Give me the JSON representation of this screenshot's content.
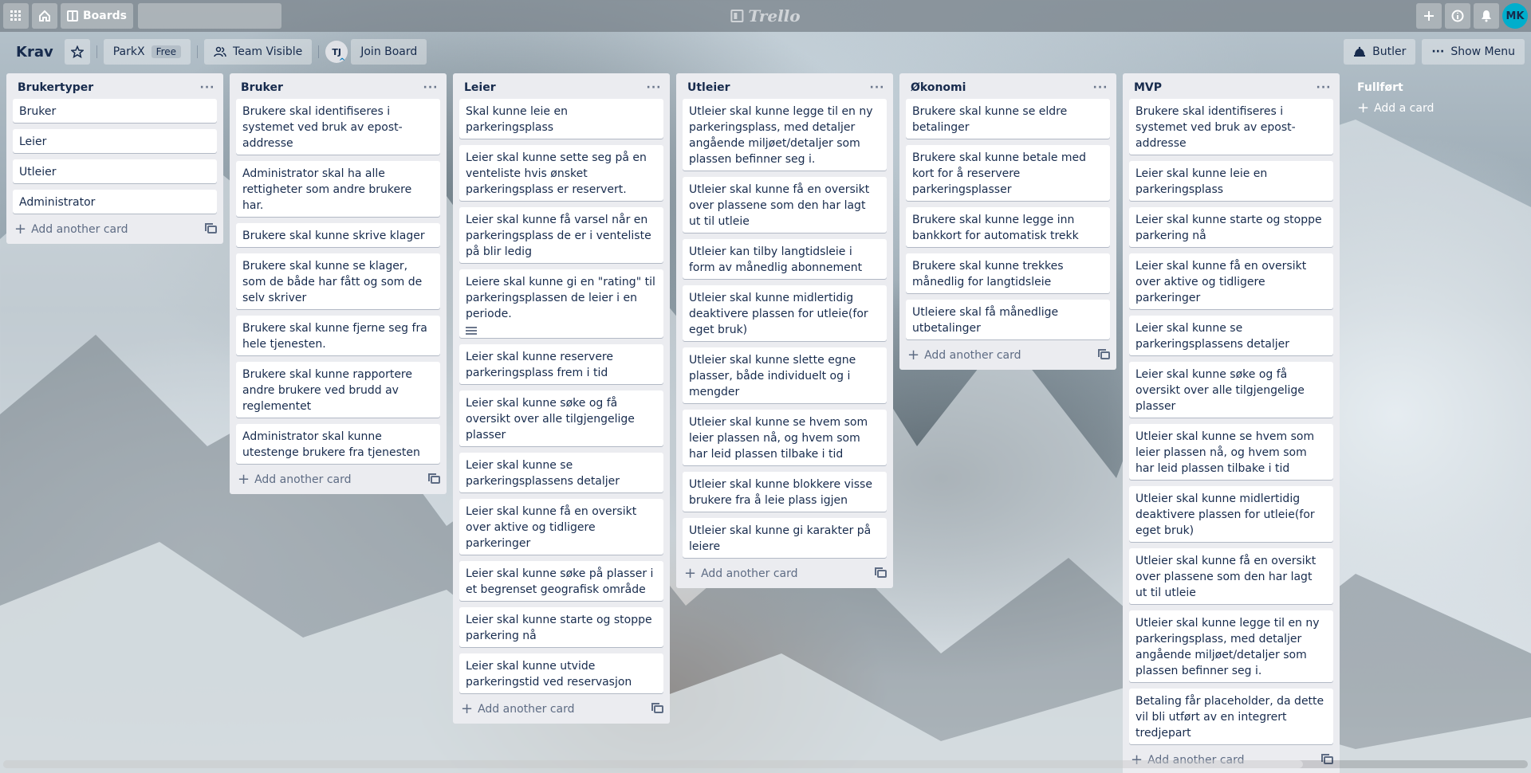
{
  "header": {
    "boards_label": "Boards",
    "search_placeholder": "",
    "logo_text": "Trello",
    "avatar_initials": "MK"
  },
  "board": {
    "title": "Krav",
    "team_name": "ParkX",
    "team_badge": "Free",
    "visibility_label": "Team Visible",
    "member_initials": "TJ",
    "join_label": "Join Board",
    "butler_label": "Butler",
    "menu_label": "Show Menu"
  },
  "lists": [
    {
      "title": "Brukertyper",
      "cards": [
        "Bruker",
        "Leier",
        "Utleier",
        "Administrator"
      ],
      "add_label": "Add another card"
    },
    {
      "title": "Bruker",
      "cards": [
        "Brukere skal identifiseres i systemet ved bruk av epost-addresse",
        "Administrator skal ha alle rettigheter som andre brukere har.",
        "Brukere skal kunne skrive klager",
        "Brukere skal kunne se klager, som de både har fått og som de selv skriver",
        "Brukere skal kunne fjerne seg fra hele tjenesten.",
        "Brukere skal kunne rapportere andre brukere ved brudd av reglementet",
        "Administrator skal kunne utestenge brukere fra tjenesten"
      ],
      "add_label": "Add another card"
    },
    {
      "title": "Leier",
      "cards": [
        "Skal kunne leie en parkeringsplass",
        "Leier skal kunne sette seg på en venteliste hvis ønsket parkeringsplass er reservert.",
        "Leier skal kunne få varsel når en parkeringsplass de er i venteliste på blir ledig",
        "Leiere skal kunne gi en \"rating\" til parkeringsplassen de leier i en periode.",
        "Leier skal kunne reservere parkeringsplass frem i tid",
        "Leier skal kunne søke og få oversikt over alle tilgjengelige plasser",
        "Leier skal kunne se parkeringsplassens detaljer",
        "Leier skal kunne få en oversikt over aktive og tidligere parkeringer",
        "Leier skal kunne søke på plasser i et begrenset geografisk område",
        "Leier skal kunne starte og stoppe parkering nå",
        "Leier skal kunne utvide parkeringstid ved reservasjon"
      ],
      "add_label": "Add another card"
    },
    {
      "title": "Utleier",
      "cards": [
        "Utleier skal kunne legge til en ny parkeringsplass, med detaljer angående miljøet/detaljer som plassen befinner seg i.",
        "Utleier skal kunne få en oversikt over plassene som den har lagt ut til utleie",
        "Utleier kan tilby langtidsleie i form av månedlig abonnement",
        "Utleier skal kunne midlertidig deaktivere plassen for utleie(for eget bruk)",
        "Utleier skal kunne slette egne plasser, både individuelt og i mengder",
        "Utleier skal kunne se hvem som leier plassen nå, og hvem som har leid plassen tilbake i tid",
        "Utleier skal kunne blokkere visse brukere fra å leie plass igjen",
        "Utleier skal kunne gi karakter på leiere"
      ],
      "add_label": "Add another card"
    },
    {
      "title": "Økonomi",
      "cards": [
        "Brukere skal kunne se eldre betalinger",
        "Brukere skal kunne betale med kort for å reservere parkeringsplasser",
        "Brukere skal kunne legge inn bankkort for automatisk trekk",
        "Brukere skal kunne trekkes månedlig for langtidsleie",
        "Utleiere skal få månedlige utbetalinger"
      ],
      "add_label": "Add another card"
    },
    {
      "title": "MVP",
      "cards": [
        "Brukere skal identifiseres i systemet ved bruk av epost-addresse",
        "Leier skal kunne leie en parkeringsplass",
        "Leier skal kunne starte og stoppe parkering nå",
        "Leier skal kunne få en oversikt over aktive og tidligere parkeringer",
        "Leier skal kunne se parkeringsplassens detaljer",
        "Leier skal kunne søke og få oversikt over alle tilgjengelige plasser",
        "Utleier skal kunne se hvem som leier plassen nå, og hvem som har leid plassen tilbake i tid",
        "Utleier skal kunne midlertidig deaktivere plassen for utleie(for eget bruk)",
        "Utleier skal kunne få en oversikt over plassene som den har lagt ut til utleie",
        "Utleier skal kunne legge til en ny parkeringsplass, med detaljer angående miljøet/detaljer som plassen befinner seg i.",
        "Betaling får placeholder, da dette vil bli utført av en integrert tredjepart"
      ],
      "add_label": "Add another card"
    }
  ],
  "empty_list": {
    "title": "Fullført",
    "add_label": "Add a card"
  },
  "colors": {
    "list_bg": "#ebecf0",
    "avatar": "#00aecc",
    "text": "#172b4d"
  }
}
